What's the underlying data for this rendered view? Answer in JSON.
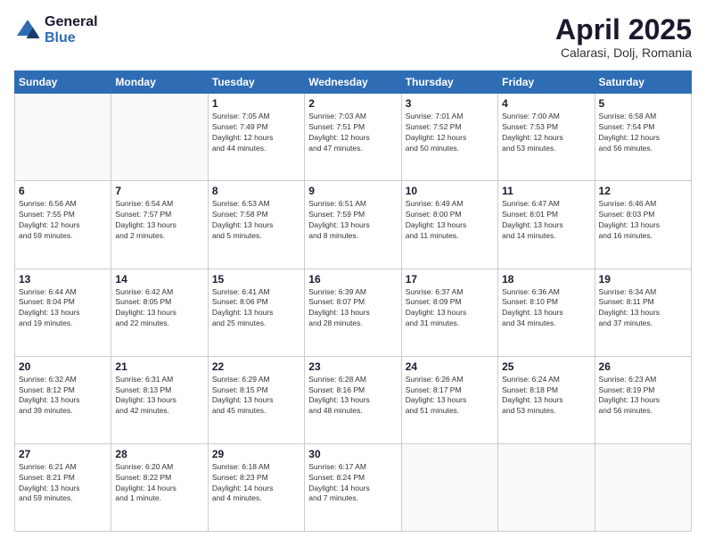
{
  "header": {
    "logo_general": "General",
    "logo_blue": "Blue",
    "month_title": "April 2025",
    "subtitle": "Calarasi, Dolj, Romania"
  },
  "weekdays": [
    "Sunday",
    "Monday",
    "Tuesday",
    "Wednesday",
    "Thursday",
    "Friday",
    "Saturday"
  ],
  "weeks": [
    [
      {
        "day": "",
        "info": ""
      },
      {
        "day": "",
        "info": ""
      },
      {
        "day": "1",
        "info": "Sunrise: 7:05 AM\nSunset: 7:49 PM\nDaylight: 12 hours\nand 44 minutes."
      },
      {
        "day": "2",
        "info": "Sunrise: 7:03 AM\nSunset: 7:51 PM\nDaylight: 12 hours\nand 47 minutes."
      },
      {
        "day": "3",
        "info": "Sunrise: 7:01 AM\nSunset: 7:52 PM\nDaylight: 12 hours\nand 50 minutes."
      },
      {
        "day": "4",
        "info": "Sunrise: 7:00 AM\nSunset: 7:53 PM\nDaylight: 12 hours\nand 53 minutes."
      },
      {
        "day": "5",
        "info": "Sunrise: 6:58 AM\nSunset: 7:54 PM\nDaylight: 12 hours\nand 56 minutes."
      }
    ],
    [
      {
        "day": "6",
        "info": "Sunrise: 6:56 AM\nSunset: 7:55 PM\nDaylight: 12 hours\nand 59 minutes."
      },
      {
        "day": "7",
        "info": "Sunrise: 6:54 AM\nSunset: 7:57 PM\nDaylight: 13 hours\nand 2 minutes."
      },
      {
        "day": "8",
        "info": "Sunrise: 6:53 AM\nSunset: 7:58 PM\nDaylight: 13 hours\nand 5 minutes."
      },
      {
        "day": "9",
        "info": "Sunrise: 6:51 AM\nSunset: 7:59 PM\nDaylight: 13 hours\nand 8 minutes."
      },
      {
        "day": "10",
        "info": "Sunrise: 6:49 AM\nSunset: 8:00 PM\nDaylight: 13 hours\nand 11 minutes."
      },
      {
        "day": "11",
        "info": "Sunrise: 6:47 AM\nSunset: 8:01 PM\nDaylight: 13 hours\nand 14 minutes."
      },
      {
        "day": "12",
        "info": "Sunrise: 6:46 AM\nSunset: 8:03 PM\nDaylight: 13 hours\nand 16 minutes."
      }
    ],
    [
      {
        "day": "13",
        "info": "Sunrise: 6:44 AM\nSunset: 8:04 PM\nDaylight: 13 hours\nand 19 minutes."
      },
      {
        "day": "14",
        "info": "Sunrise: 6:42 AM\nSunset: 8:05 PM\nDaylight: 13 hours\nand 22 minutes."
      },
      {
        "day": "15",
        "info": "Sunrise: 6:41 AM\nSunset: 8:06 PM\nDaylight: 13 hours\nand 25 minutes."
      },
      {
        "day": "16",
        "info": "Sunrise: 6:39 AM\nSunset: 8:07 PM\nDaylight: 13 hours\nand 28 minutes."
      },
      {
        "day": "17",
        "info": "Sunrise: 6:37 AM\nSunset: 8:09 PM\nDaylight: 13 hours\nand 31 minutes."
      },
      {
        "day": "18",
        "info": "Sunrise: 6:36 AM\nSunset: 8:10 PM\nDaylight: 13 hours\nand 34 minutes."
      },
      {
        "day": "19",
        "info": "Sunrise: 6:34 AM\nSunset: 8:11 PM\nDaylight: 13 hours\nand 37 minutes."
      }
    ],
    [
      {
        "day": "20",
        "info": "Sunrise: 6:32 AM\nSunset: 8:12 PM\nDaylight: 13 hours\nand 39 minutes."
      },
      {
        "day": "21",
        "info": "Sunrise: 6:31 AM\nSunset: 8:13 PM\nDaylight: 13 hours\nand 42 minutes."
      },
      {
        "day": "22",
        "info": "Sunrise: 6:29 AM\nSunset: 8:15 PM\nDaylight: 13 hours\nand 45 minutes."
      },
      {
        "day": "23",
        "info": "Sunrise: 6:28 AM\nSunset: 8:16 PM\nDaylight: 13 hours\nand 48 minutes."
      },
      {
        "day": "24",
        "info": "Sunrise: 6:26 AM\nSunset: 8:17 PM\nDaylight: 13 hours\nand 51 minutes."
      },
      {
        "day": "25",
        "info": "Sunrise: 6:24 AM\nSunset: 8:18 PM\nDaylight: 13 hours\nand 53 minutes."
      },
      {
        "day": "26",
        "info": "Sunrise: 6:23 AM\nSunset: 8:19 PM\nDaylight: 13 hours\nand 56 minutes."
      }
    ],
    [
      {
        "day": "27",
        "info": "Sunrise: 6:21 AM\nSunset: 8:21 PM\nDaylight: 13 hours\nand 59 minutes."
      },
      {
        "day": "28",
        "info": "Sunrise: 6:20 AM\nSunset: 8:22 PM\nDaylight: 14 hours\nand 1 minute."
      },
      {
        "day": "29",
        "info": "Sunrise: 6:18 AM\nSunset: 8:23 PM\nDaylight: 14 hours\nand 4 minutes."
      },
      {
        "day": "30",
        "info": "Sunrise: 6:17 AM\nSunset: 8:24 PM\nDaylight: 14 hours\nand 7 minutes."
      },
      {
        "day": "",
        "info": ""
      },
      {
        "day": "",
        "info": ""
      },
      {
        "day": "",
        "info": ""
      }
    ]
  ]
}
